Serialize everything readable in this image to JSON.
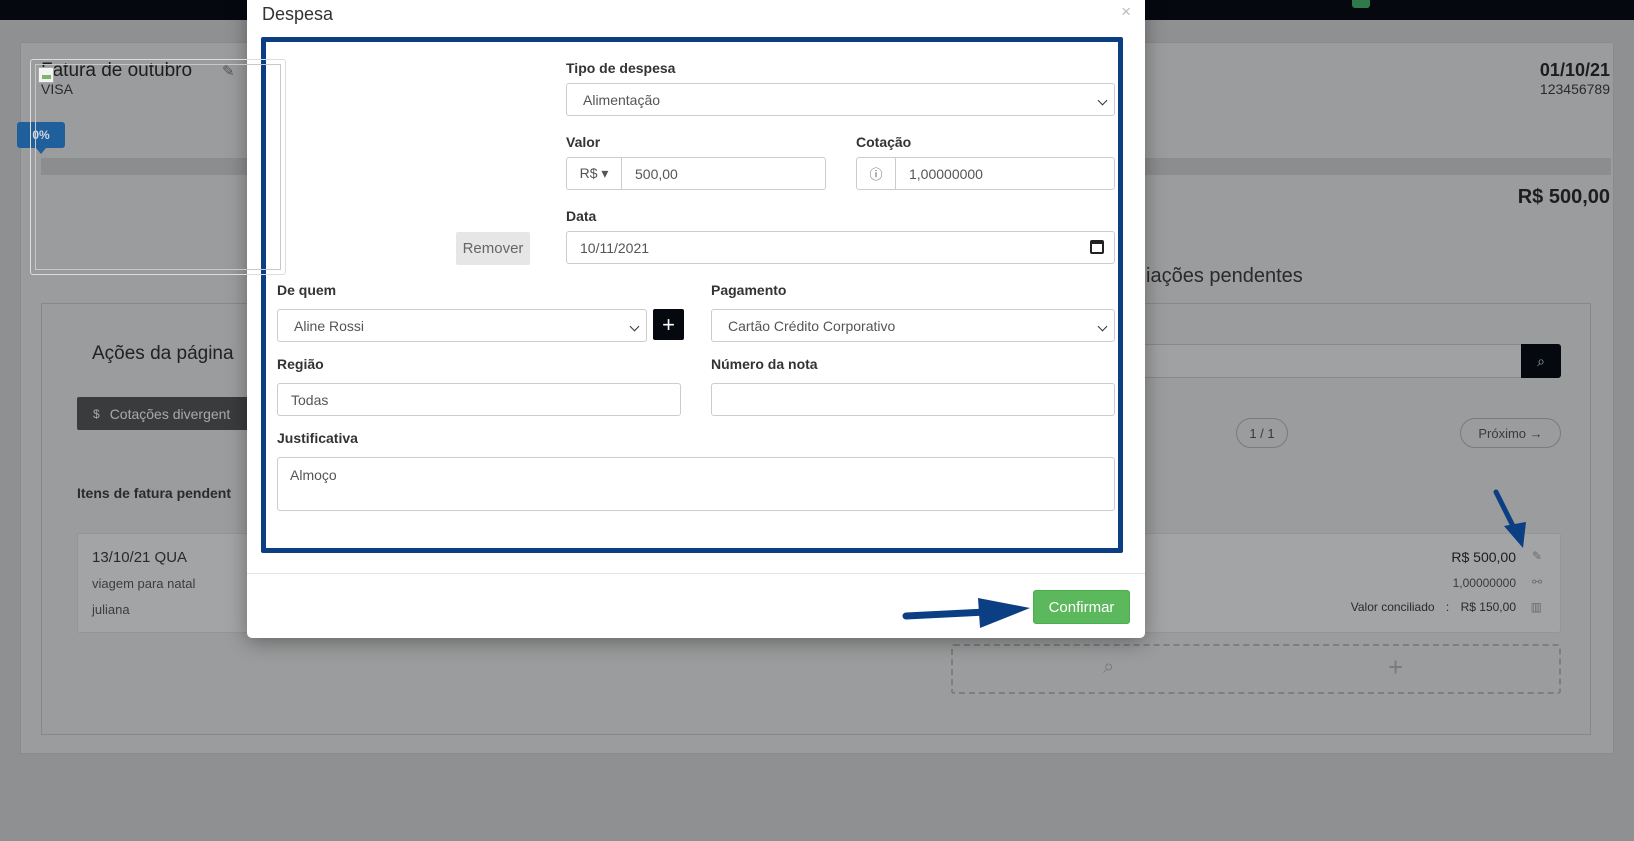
{
  "background": {
    "invoice_title": "Fatura de outubro",
    "card_brand": "VISA",
    "invoice_date": "01/10/21",
    "invoice_number": "123456789",
    "progress_percent": "0%",
    "progress_value": 0,
    "total": "R$ 500,00",
    "actions_title": "Ações da página",
    "divergent_button_icon": "$",
    "divergent_button": "Cotações divergent",
    "pending_items_label": "Itens de fatura pendent",
    "conciliation_title": "iações pendentes",
    "pager": "1 / 1",
    "next_button": "Próximo →",
    "item": {
      "date": "13/10/21 QUA",
      "description": "viagem para natal",
      "user": "juliana",
      "amount": "R$ 500,00",
      "rate": "1,00000000",
      "conciliated_label": "Valor conciliado",
      "conciliated_sep": ":",
      "conciliated_value": "R$ 150,00"
    }
  },
  "modal": {
    "title": "Despesa",
    "close": "×",
    "remove_image": "Remover",
    "expense_type_label": "Tipo de despesa",
    "expense_type_value": "Alimentação",
    "value_label": "Valor",
    "currency": "R$ ▾",
    "value": "500,00",
    "rate_label": "Cotação",
    "rate_icon": "ⓘ",
    "rate": "1,00000000",
    "date_label": "Data",
    "date": "10/11/2021",
    "from_label": "De quem",
    "from_value": "Aline Rossi",
    "add_icon": "+",
    "payment_label": "Pagamento",
    "payment_value": "Cartão Crédito Corporativo",
    "region_label": "Região",
    "region_value": "Todas",
    "invoice_number_label": "Número da nota",
    "invoice_number_value": "",
    "justification_label": "Justificativa",
    "justification_value": "Almoço",
    "confirm_button": "Confirmar"
  },
  "colors": {
    "frame": "#0b3e82",
    "confirm": "#5cb85c",
    "arrow": "#0b3e82",
    "badge": "#1f5f9c"
  }
}
